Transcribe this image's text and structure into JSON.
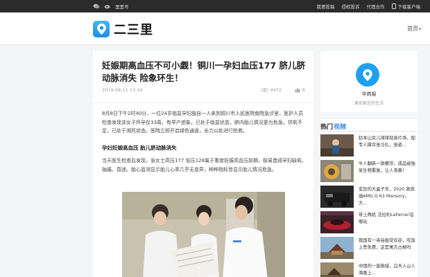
{
  "topbar": {
    "site_name": "里里号",
    "links": [
      "我要投稿",
      "侵权投诉",
      "代理合作",
      "下载客户端"
    ]
  },
  "header": {
    "logo_text": "二三里",
    "home_link": "首页»"
  },
  "article": {
    "title": "妊娠期高血压不可小觑！铜川一孕妇血压177 脐儿脐动脉消失 险象环生！",
    "date": "2019-08-11 13:34",
    "views": "4472",
    "likes": "6",
    "paragraph1": "8月8日下午2时40分，一位24岁临盆孕妇独自一人来到铜川市人民医院南院急诊室，医护人员检查发现该女子怀孕仅33周，有早产迹象，已处于临盆状态，脐内胎儿情况更为危急，供氧不足，已处于濒死状态。医院立即开启绿色通道，全力以赴进行抢救。",
    "subheading": "孕妇妊娠高血压 胎儿脐动脉消失",
    "paragraph2": "当天医生检查后发现，张女士高压177 低压128属于重度妊娠高血压前期，极易造成孕妇缺氧、抽搐、昏迷。胎心监测显示胎儿心率几乎无变异，种种指标皆显示胎儿情况危急。"
  },
  "profile": {
    "name": "华商报",
    "description": "离你更近的生活"
  },
  "hot": {
    "title_part1": "热门",
    "title_part2": "视频",
    "items": [
      {
        "text": "赵本山女儿球球现身片场，配专人撑伞坐马扎，坐姿..."
      },
      {
        "text": "牛人翻新一款螺帝，成品被独家生物重复，让人羡慕！"
      },
      {
        "text": "变异的大盒子车，2020 款奔驰AMG G 63 Mansory，大..."
      },
      {
        "text": "带上两机 法拉利LaFerrari在哪玩"
      },
      {
        "text": "我国有一寺庙极受欢迎，吃饭上贵免费，这是寓言占掉吗"
      },
      {
        "text": "中国的一座佛城，白天人山人海晚上..."
      }
    ]
  },
  "colors": {
    "topbar_bg": "#2b2b2b",
    "brand_blue": "#1ea0f0",
    "accent": "#3a8ee6"
  }
}
